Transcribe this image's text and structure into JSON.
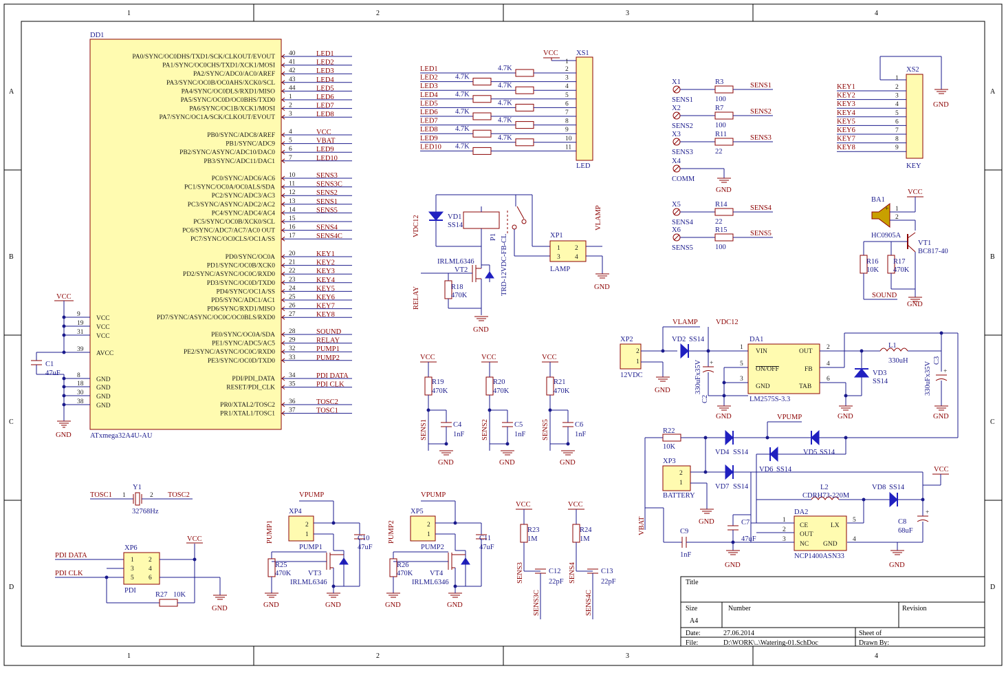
{
  "sheet": {
    "col_labels": [
      "1",
      "2",
      "3",
      "4"
    ],
    "row_labels": [
      "A",
      "B",
      "C",
      "D"
    ]
  },
  "mcu": {
    "ref": "DD1",
    "part": "ATxmega32A4U-AU",
    "port_a": [
      {
        "pin": "40",
        "name": "PA0/SYNC/OC0DHS/TXD1/SCK/CLKOUT/EVOUT",
        "net": "LED1"
      },
      {
        "pin": "41",
        "name": "PA1/SYNC/OC0CHS/TXD1/XCK1/MOSI",
        "net": "LED2"
      },
      {
        "pin": "42",
        "name": "PA2/SYNC/ADC0/AC0/AREF",
        "net": "LED3"
      },
      {
        "pin": "43",
        "name": "PA3/SYNC/OC0B/OC0AHS/XCK0/SCL",
        "net": "LED4"
      },
      {
        "pin": "44",
        "name": "PA4/SYNC/OC0DLS/RXD1/MISO",
        "net": "LED5"
      },
      {
        "pin": "1",
        "name": "PA5/SYNC/OC0D/OC0BHS/TXD0",
        "net": "LED6"
      },
      {
        "pin": "2",
        "name": "PA6/SYNC/OC1B/XCK1/MOSI",
        "net": "LED7"
      },
      {
        "pin": "3",
        "name": "PA7/SYNC/OC1A/SCK/CLKOUT/EVOUT",
        "net": "LED8"
      }
    ],
    "port_b": [
      {
        "pin": "4",
        "name": "PB0/SYNC/ADC8/AREF",
        "net": "VCC"
      },
      {
        "pin": "5",
        "name": "PB1/SYNC/ADC9",
        "net": "VBAT"
      },
      {
        "pin": "6",
        "name": "PB2/SYNC/ASYNC/ADC10/DAC0",
        "net": "LED9"
      },
      {
        "pin": "7",
        "name": "PB3/SYNC/ADC11/DAC1",
        "net": "LED10"
      }
    ],
    "port_c": [
      {
        "pin": "10",
        "name": "PC0/SYNC/ADC6/AC6",
        "net": "SENS3"
      },
      {
        "pin": "11",
        "name": "PC1/SYNC/OC0A/OC0ALS/SDA",
        "net": "SENS3C"
      },
      {
        "pin": "12",
        "name": "PC2/SYNC/ADC3/AC3",
        "net": "SENS2"
      },
      {
        "pin": "13",
        "name": "PC3/SYNC/ASYNC/ADC2/AC2",
        "net": "SENS1"
      },
      {
        "pin": "14",
        "name": "PC4/SYNC/ADC4/AC4",
        "net": "SENS5"
      },
      {
        "pin": "15",
        "name": "PC5/SYNC/OC0B/XCK0/SCL",
        "net": ""
      },
      {
        "pin": "16",
        "name": "PC6/SYNC/ADC7/AC7/AC0 OUT",
        "net": "SENS4"
      },
      {
        "pin": "17",
        "name": "PC7/SYNC/OC0CLS/OC1A/SS",
        "net": "SENS4C"
      }
    ],
    "port_d": [
      {
        "pin": "20",
        "name": "PD0/SYNC/OC0A",
        "net": "KEY1"
      },
      {
        "pin": "21",
        "name": "PD1/SYNC/OC0B/XCK0",
        "net": "KEY2"
      },
      {
        "pin": "22",
        "name": "PD2/SYNC/ASYNC/OC0C/RXD0",
        "net": "KEY3"
      },
      {
        "pin": "23",
        "name": "PD3/SYNC/OC0D/TXD0",
        "net": "KEY4"
      },
      {
        "pin": "24",
        "name": "PD4/SYNC/OC1A/SS",
        "net": "KEY5"
      },
      {
        "pin": "25",
        "name": "PD5/SYNC/ADC1/AC1",
        "net": "KEY6"
      },
      {
        "pin": "26",
        "name": "PD6/SYNC/RXD1/MISO",
        "net": "KEY7"
      },
      {
        "pin": "27",
        "name": "PD7/SYNC/ASYNC/OC0C/OC0BLS/RXD0",
        "net": "KEY8"
      }
    ],
    "port_e": [
      {
        "pin": "28",
        "name": "PE0/SYNC/OC0A/SDA",
        "net": "SOUND"
      },
      {
        "pin": "29",
        "name": "PE1/SYNC/ADC5/AC5",
        "net": "RELAY"
      },
      {
        "pin": "32",
        "name": "PE2/SYNC/ASYNC/OC0C/RXD0",
        "net": "PUMP1"
      },
      {
        "pin": "33",
        "name": "PE3/SYNC/OC0D/TXD0",
        "net": "PUMP2"
      }
    ],
    "pdi": [
      {
        "pin": "34",
        "name": "PDI/PDI_DATA",
        "net": "PDI DATA"
      },
      {
        "pin": "35",
        "name": "RESET/PDI_CLK",
        "net": "PDI CLK"
      }
    ],
    "osc": [
      {
        "pin": "36",
        "name": "PR0/XTAL2/TOSC2",
        "net": "TOSC2"
      },
      {
        "pin": "37",
        "name": "PR1/XTAL1/TOSC1",
        "net": "TOSC1"
      }
    ],
    "power_left": [
      {
        "pin": "9",
        "name": "VCC"
      },
      {
        "pin": "19",
        "name": "VCC"
      },
      {
        "pin": "31",
        "name": "VCC"
      },
      {
        "pin": "39",
        "name": "AVCC"
      },
      {
        "pin": "8",
        "name": "GND"
      },
      {
        "pin": "18",
        "name": "GND"
      },
      {
        "pin": "30",
        "name": "GND"
      },
      {
        "pin": "38",
        "name": "GND"
      }
    ]
  },
  "labels": {
    "vcc": "VCC",
    "gnd": "GND",
    "c1": "C1",
    "c1_val": "47uF",
    "xs1": "XS1",
    "xs1_name": "LED",
    "xs2": "XS2",
    "xs2_name": "KEY",
    "r_47k": "4.7K",
    "vd1": "VD1",
    "vd1_val": "SS14",
    "vdc12": "VDC12",
    "relay": "RELAY",
    "p1": "P1",
    "p1_val": "TRD-12VDC-FB-CL",
    "vt2_part": "IRLML6346",
    "vt2": "VT2",
    "r18": "R18",
    "r18_val": "470K",
    "xp1": "XP1",
    "lamp": "LAMP",
    "vlamp": "VLAMP",
    "x1": "X1",
    "x2": "X2",
    "x3": "X3",
    "x4": "X4",
    "x5": "X5",
    "x6": "X6",
    "sens1": "SENS1",
    "sens2": "SENS2",
    "sens3": "SENS3",
    "comm": "COMM",
    "sens4": "SENS4",
    "sens5": "SENS5",
    "sens3c": "SENS3C",
    "sens4c": "SENS4C",
    "r3": "R3",
    "r3v": "100",
    "r7": "R7",
    "r7v": "100",
    "r11": "R11",
    "r11v": "22",
    "r14": "R14",
    "r14v": "22",
    "r15": "R15",
    "r15v": "100",
    "ba1": "BA1",
    "ba1_val": "HC0905A",
    "vt1": "VT1",
    "vt1_val": "BC817-40",
    "r16": "R16",
    "r16v": "10K",
    "r17": "R17",
    "r17v": "470K",
    "sound": "SOUND",
    "xp2": "XP2",
    "xp2_val": "12VDC",
    "vd2": "VD2",
    "vd2_val": "SS14",
    "c2_val": "330uFx35V",
    "c2": "C2",
    "da1": "DA1",
    "da1_vin": "VIN",
    "da1_out": "OUT",
    "da1_onoff": "ON/OFF",
    "da1_fb": "FB",
    "da1_gnd": "GND",
    "da1_tab": "TAB",
    "da1_part": "LM2575S-3.3",
    "vd3": "VD3",
    "vd3_val": "SS14",
    "l1": "L1",
    "l1_val": "330uH",
    "c3": "C3",
    "c3_val": "330uFx35V",
    "r19": "R19",
    "r20": "R20",
    "r21": "R21",
    "r_470k": "470K",
    "c4": "C4",
    "c5": "C5",
    "c6": "C6",
    "nf1": "1nF",
    "vpump": "VPUMP",
    "r22": "R22",
    "r22v": "10K",
    "vd4": "VD4",
    "vd5": "VD5",
    "vd6": "VD6",
    "vd7": "VD7",
    "vd8": "VD8",
    "ss14": "SS14",
    "xp3": "XP3",
    "battery": "BATTERY",
    "vbat": "VBAT",
    "c9": "C9",
    "c7": "C7",
    "c7v": "47uF",
    "l2": "L2",
    "l2_val": "CDRH73-220M",
    "da2": "DA2",
    "da2_ce": "CE",
    "da2_lx": "LX",
    "da2_out": "OUT",
    "da2_nc": "NC",
    "da2_gnd": "GND",
    "da2_part": "NCP1400ASN33",
    "c8": "C8",
    "c8v": "68uF",
    "y1": "Y1",
    "y1_val": "32768Hz",
    "tosc1": "TOSC1",
    "tosc2": "TOSC2",
    "xp6": "XP6",
    "pdi": "PDI",
    "pdi_data": "PDI DATA",
    "pdi_clk": "PDI CLK",
    "r27": "R27",
    "r27v": "10K",
    "xp4": "XP4",
    "xp5": "XP5",
    "pump1": "PUMP1",
    "pump2": "PUMP2",
    "c10": "C10",
    "c11": "C11",
    "c10v": "47uF",
    "r25": "R25",
    "r26": "R26",
    "vt3": "VT3",
    "vt4": "VT4",
    "irlml": "IRLML6346",
    "r23": "R23",
    "r24": "R24",
    "r1m": "1M",
    "c12": "C12",
    "c13": "C13",
    "pf22": "22pF"
  },
  "title_block": {
    "title_label": "Title",
    "size_label": "Size",
    "size_value": "A4",
    "number_label": "Number",
    "revision_label": "Revision",
    "date_label": "Date:",
    "date_value": "27.06.2014",
    "file_label": "File:",
    "file_value": "D:\\WORK\\..\\Watering-01.SchDoc",
    "sheet_label": "Sheet    of",
    "drawn_label": "Drawn By:"
  }
}
